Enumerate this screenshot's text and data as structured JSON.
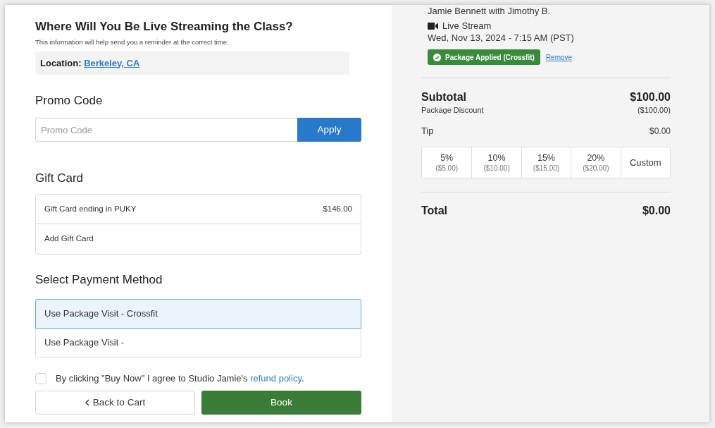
{
  "location_section": {
    "title": "Where Will You Be Live Streaming the Class?",
    "subtitle": "This information will help send you a reminder at the correct time.",
    "location_label": "Location:",
    "location_value": "Berkeley, CA"
  },
  "promo": {
    "title": "Promo Code",
    "placeholder": "Promo Code",
    "button": "Apply"
  },
  "gift_card": {
    "title": "Gift Card",
    "cards": [
      {
        "label": "Gift Card ending in PUKY",
        "amount": "$146.00"
      }
    ],
    "add_label": "Add Gift Card"
  },
  "payment": {
    "title": "Select Payment Method",
    "methods": [
      {
        "label": "Use Package Visit - Crossfit",
        "selected": true
      },
      {
        "label": "Use Package Visit -",
        "selected": false
      }
    ]
  },
  "agreement": {
    "checked": false,
    "text": "By clicking \"Buy Now\" I agree to Studio Jamie's",
    "link": "refund policy",
    "end": "."
  },
  "actions": {
    "back": "Back to Cart",
    "book": "Book"
  },
  "summary": {
    "instructor": "Jamie Bennett with Jimothy B.",
    "format": "Live Stream",
    "datetime": "Wed, Nov 13, 2024 - 7:15 AM (PST)",
    "badge": "Package Applied (Crossfit)",
    "remove": "Remove",
    "subtotal_label": "Subtotal",
    "subtotal": "$100.00",
    "discount_label": "Package Discount",
    "discount": "($100.00)",
    "tip_label": "Tip",
    "tip": "$0.00",
    "tip_options": [
      {
        "kind": "percent",
        "percent": "5%",
        "amount": "($5.00)",
        "selected": false
      },
      {
        "kind": "percent",
        "percent": "10%",
        "amount": "($10.00)",
        "selected": false
      },
      {
        "kind": "percent",
        "percent": "15%",
        "amount": "($15.00)",
        "selected": false
      },
      {
        "kind": "percent",
        "percent": "20%",
        "amount": "($20.00)",
        "selected": false
      },
      {
        "kind": "custom",
        "label": "Custom",
        "selected": false
      }
    ],
    "total_label": "Total",
    "total": "$0.00"
  }
}
